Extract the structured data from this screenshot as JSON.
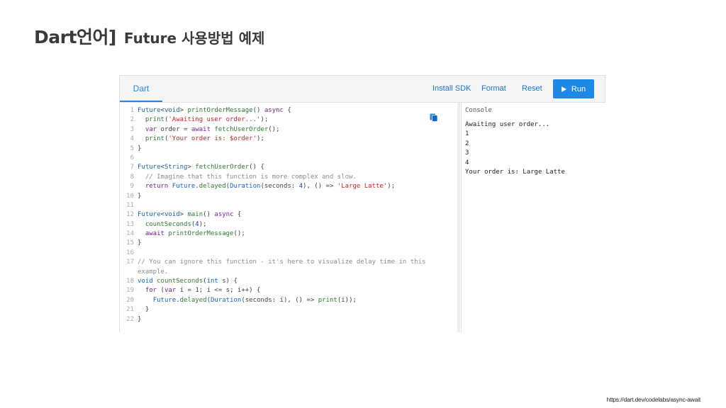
{
  "title": {
    "main": "Dart언어]",
    "sub": "Future 사용방법 예제"
  },
  "dartpad": {
    "tab_label": "Dart",
    "toolbar": {
      "install_sdk": "Install SDK",
      "format": "Format",
      "reset": "Reset",
      "run": "Run"
    },
    "code_lines": [
      "1",
      "2",
      "3",
      "4",
      "5",
      "6",
      "7",
      "8",
      "9",
      "10",
      "11",
      "12",
      "13",
      "14",
      "15",
      "16",
      "17",
      "18",
      "19",
      "20",
      "21",
      "22"
    ],
    "console": {
      "title": "Console",
      "output": [
        "Awaiting user order...",
        "1",
        "2",
        "3",
        "4",
        "Your order is: Large Latte"
      ]
    }
  },
  "source_url": "https://dart.dev/codelabs/async-await",
  "colors": {
    "accent": "#1e88e5",
    "keyword": "#7b1fa2",
    "type": "#1565c0",
    "string": "#c62828",
    "function": "#2e7d32",
    "comment": "#8d8d8d"
  },
  "icons": {
    "copy": "copy-icon",
    "run": "play-icon"
  }
}
